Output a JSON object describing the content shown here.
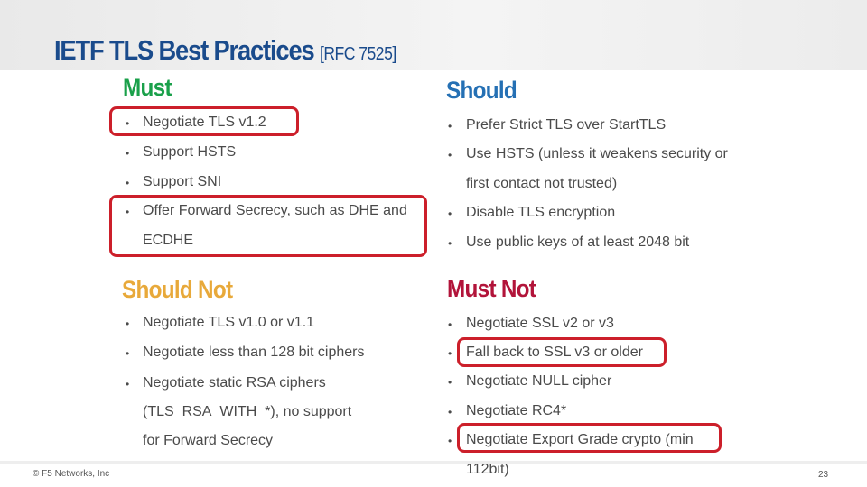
{
  "title": {
    "main": "IETF TLS Best Practices",
    "ref": "[RFC 7525]"
  },
  "colors": {
    "title": "#1a4b8c",
    "must": "#1aa04a",
    "should": "#2570b4",
    "should_not": "#e8a93a",
    "must_not": "#b2143a",
    "highlight": "#cc1f2a"
  },
  "sections": {
    "must": {
      "heading": "Must",
      "items": [
        "Negotiate TLS v1.2",
        "Support HSTS",
        "Support SNI",
        "Offer Forward Secrecy, such as DHE and",
        "ECDHE"
      ]
    },
    "should": {
      "heading": "Should",
      "items": [
        "Prefer Strict TLS over StartTLS",
        "Use HSTS (unless it weakens security or",
        "first contact not trusted)",
        "Disable TLS encryption",
        "Use public keys of at least 2048 bit"
      ]
    },
    "should_not": {
      "heading": "Should Not",
      "items": [
        "Negotiate TLS v1.0 or v1.1",
        "Negotiate less than 128 bit ciphers",
        "Negotiate static RSA ciphers",
        "(TLS_RSA_WITH_*), no support",
        "for Forward Secrecy"
      ]
    },
    "must_not": {
      "heading": "Must Not",
      "items": [
        "Negotiate SSL v2 or v3",
        "Fall back to SSL v3 or older",
        "Negotiate NULL cipher",
        "Negotiate RC4*",
        "Negotiate Export Grade crypto (min",
        "112bit)"
      ]
    }
  },
  "bullet": "•",
  "footer": {
    "copyright": "© F5 Networks, Inc",
    "page": "23"
  }
}
